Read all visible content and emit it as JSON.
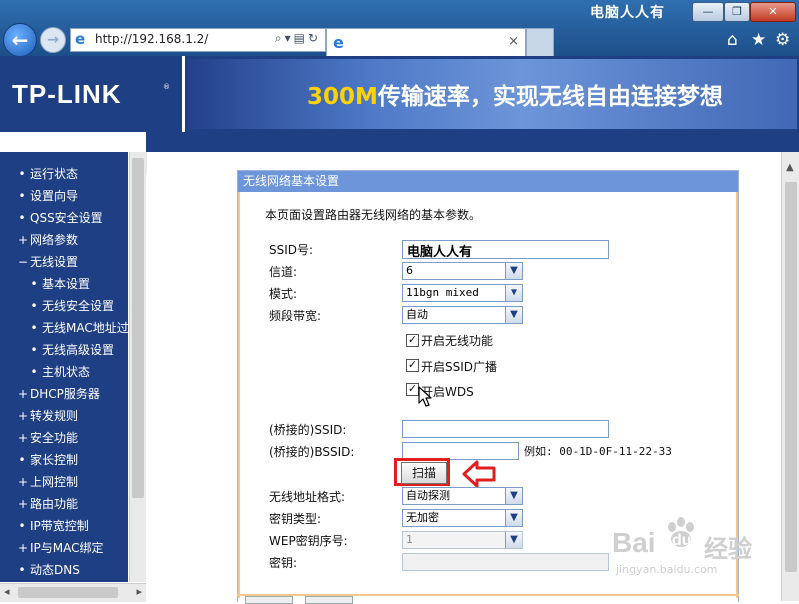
{
  "browser": {
    "window_title": "电脑人人有",
    "url": "http://192.168.1.2/",
    "tab_close": "×",
    "window_buttons": [
      "—",
      "❐",
      "✕"
    ],
    "icons": [
      "back-icon",
      "forward-icon",
      "ie-icon",
      "search-icon",
      "compat-view-icon",
      "refresh-icon",
      "home-icon",
      "favorites-star-icon",
      "settings-gear-icon"
    ]
  },
  "header": {
    "brand": "TP-LINK",
    "brand_mark": "®",
    "slogan_highlight": "300M",
    "slogan_rest": "传输速率，实现无线自由连接梦想"
  },
  "sidebar": {
    "items": [
      {
        "label": "运行状态",
        "marker": "•",
        "level": 0
      },
      {
        "label": "设置向导",
        "marker": "•",
        "level": 0
      },
      {
        "label": "QSS安全设置",
        "marker": "•",
        "level": 0
      },
      {
        "label": "网络参数",
        "marker": "+",
        "level": 0
      },
      {
        "label": "无线设置",
        "marker": "−",
        "level": 0
      },
      {
        "label": "基本设置",
        "marker": "•",
        "level": 1
      },
      {
        "label": "无线安全设置",
        "marker": "•",
        "level": 1
      },
      {
        "label": "无线MAC地址过滤",
        "marker": "•",
        "level": 1
      },
      {
        "label": "无线高级设置",
        "marker": "•",
        "level": 1
      },
      {
        "label": "主机状态",
        "marker": "•",
        "level": 1
      },
      {
        "label": "DHCP服务器",
        "marker": "+",
        "level": 0
      },
      {
        "label": "转发规则",
        "marker": "+",
        "level": 0
      },
      {
        "label": "安全功能",
        "marker": "+",
        "level": 0
      },
      {
        "label": "家长控制",
        "marker": "•",
        "level": 0
      },
      {
        "label": "上网控制",
        "marker": "+",
        "level": 0
      },
      {
        "label": "路由功能",
        "marker": "+",
        "level": 0
      },
      {
        "label": "IP带宽控制",
        "marker": "•",
        "level": 0
      },
      {
        "label": "IP与MAC绑定",
        "marker": "+",
        "level": 0
      },
      {
        "label": "动态DNS",
        "marker": "•",
        "level": 0
      }
    ]
  },
  "panel": {
    "title": "无线网络基本设置",
    "intro": "本页面设置路由器无线网络的基本参数。",
    "ssid_label": "SSID号:",
    "ssid_value": "电脑人人有",
    "channel_label": "信道:",
    "channel_value": "6",
    "mode_label": "模式:",
    "mode_value": "11bgn mixed",
    "bandwidth_label": "频段带宽:",
    "bandwidth_value": "自动",
    "enable_wireless_label": "开启无线功能",
    "enable_ssid_broadcast_label": "开启SSID广播",
    "enable_wds_label": "开启WDS",
    "checkmark": "✓",
    "bridge_ssid_label": "(桥接的)SSID:",
    "bridge_ssid_value": "",
    "bridge_bssid_label": "(桥接的)BSSID:",
    "bridge_bssid_value": "",
    "example_text": "例如: 00-1D-0F-11-22-33",
    "scan_button": "扫描",
    "addr_format_label": "无线地址格式:",
    "addr_format_value": "自动探测",
    "key_type_label": "密钥类型:",
    "key_type_value": "无加密",
    "wep_index_label": "WEP密钥序号:",
    "wep_index_value": "1",
    "key_label": "密钥:",
    "key_value": ""
  },
  "watermark": {
    "brand": "Bai",
    "paw": "du",
    "cn": "经验",
    "url": "jingyan.baidu.com"
  },
  "colors": {
    "nav_blue": "#1f3f85",
    "panel_title": "#6d95d9",
    "highlight_red": "#e21f1f",
    "slogan_yellow": "#ffd200"
  }
}
